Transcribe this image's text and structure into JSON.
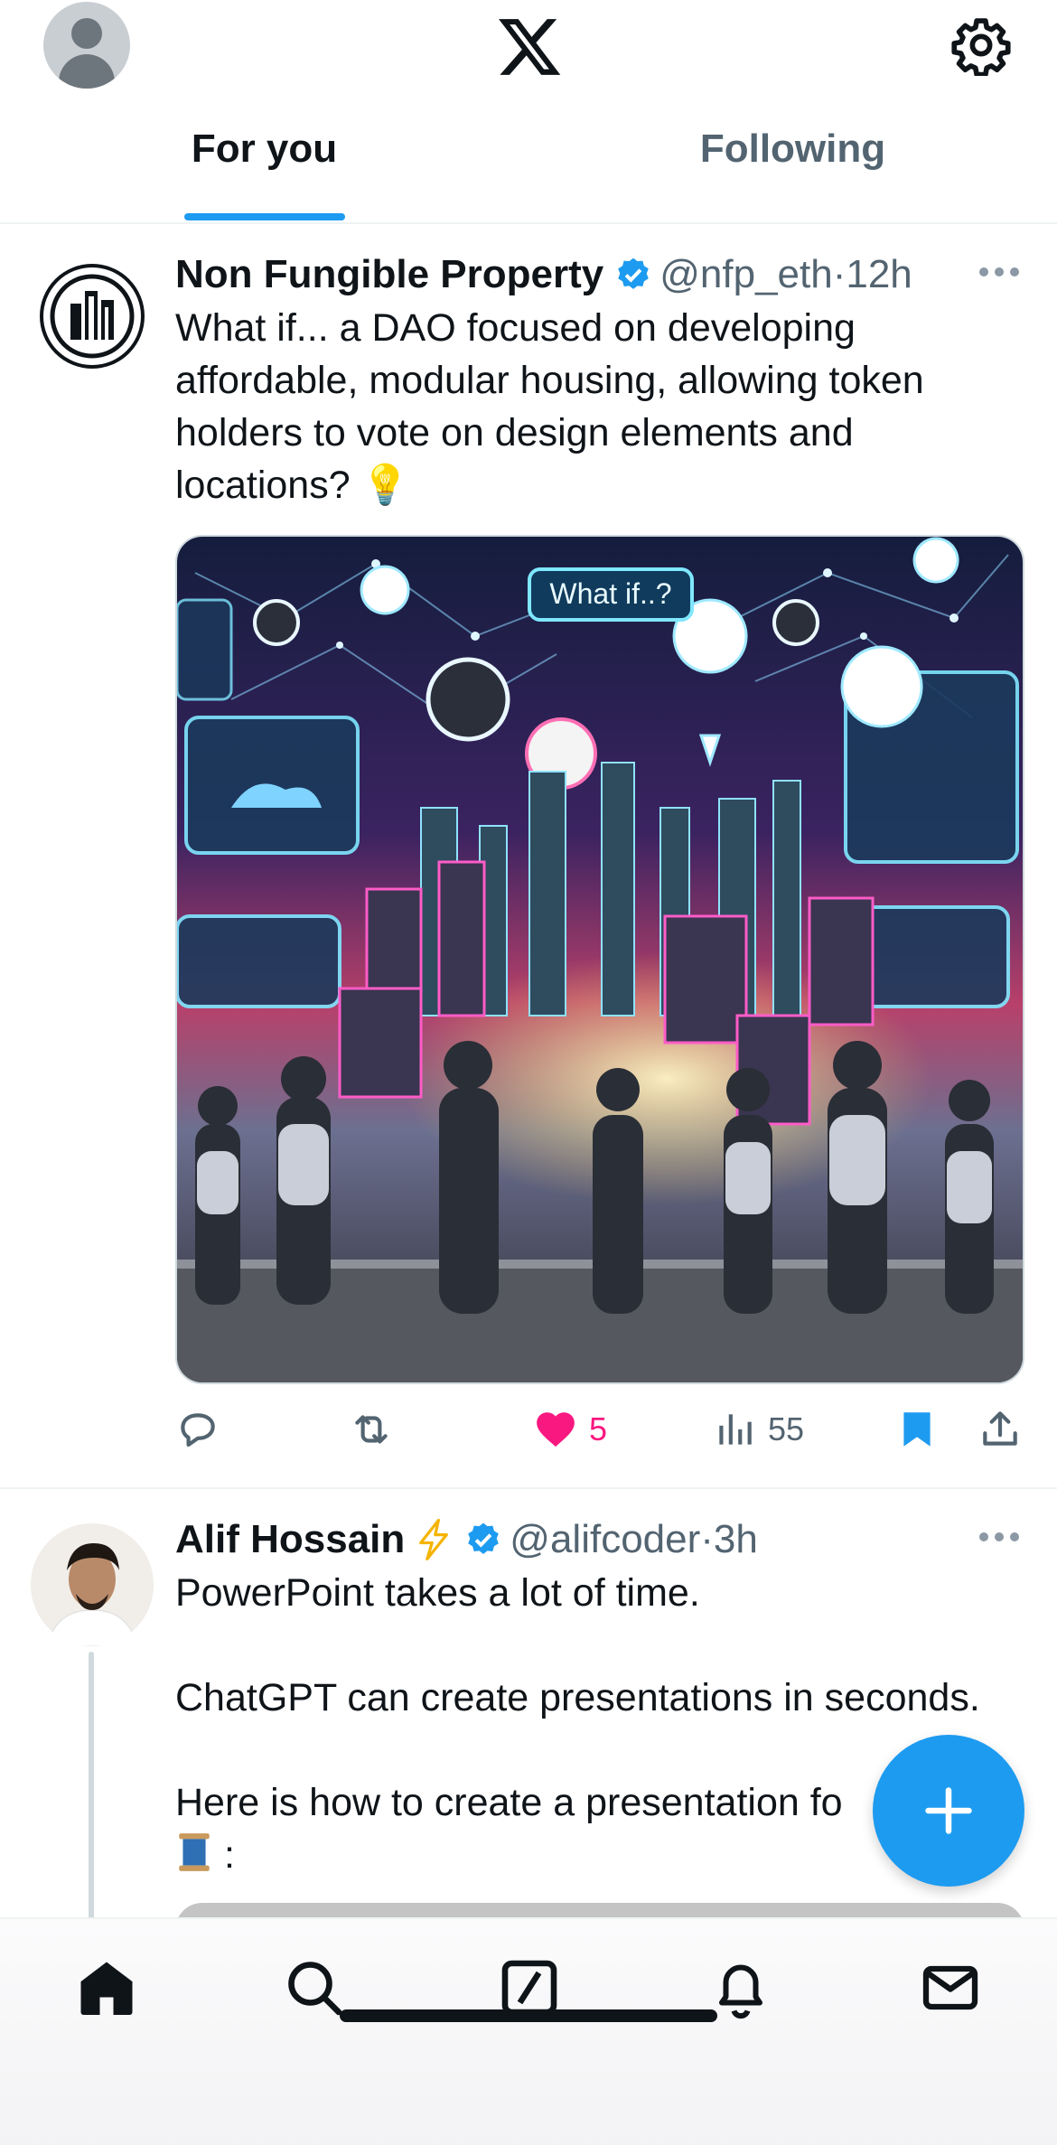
{
  "header": {
    "logo": "x-logo",
    "tabs": [
      {
        "label": "For you",
        "active": true
      },
      {
        "label": "Following",
        "active": false
      }
    ]
  },
  "tweets": [
    {
      "name": "Non Fungible Property",
      "verified": true,
      "handle": "@nfp_eth",
      "separator": "·",
      "time": "12h",
      "body": "What if... a DAO focused on developing\naffordable, modular housing, allowing token\nholders to vote on design elements and\nlocations? ",
      "body_emoji": "💡",
      "media_text": "What if..?",
      "actions": {
        "reply_count": "",
        "retweet_count": "",
        "like_count": "5",
        "views_count": "55",
        "bookmarked": true
      }
    },
    {
      "name": "Alif Hossain",
      "name_emoji": "⚡",
      "verified": true,
      "handle": "@alifcoder",
      "separator": "·",
      "time": "3h",
      "body": "PowerPoint takes a lot of time.\n\nChatGPT can create presentations in seconds.\n\nHere is how to create a presentation fo",
      "body_tail": " :",
      "body_emoji": "🧵"
    }
  ],
  "colors": {
    "accent": "#1d9bf0",
    "like": "#f91880",
    "text_primary": "#0f1419",
    "text_secondary": "#536471"
  },
  "bottom_nav": [
    "home-icon",
    "search-icon",
    "grok-icon",
    "notifications-icon",
    "messages-icon"
  ]
}
